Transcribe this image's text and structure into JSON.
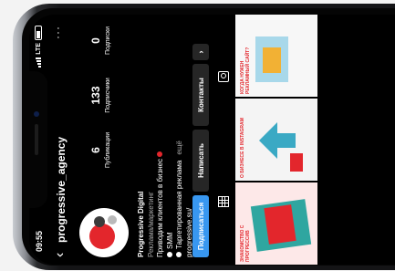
{
  "status": {
    "time": "09:55",
    "network": "LTE"
  },
  "profile": {
    "username": "progressive_agency",
    "posts_count": "6",
    "posts_label": "Публикации",
    "followers_count": "133",
    "followers_label": "Подписчики",
    "following_count": "0",
    "following_label": "Подписки",
    "name": "Progressive Digital",
    "category": "Реклама/маркетинг",
    "bio_line1": "Приводим клиентов в бизнес",
    "bio_line2": "SMM",
    "bio_line3": "Таргетированная реклама",
    "more_link": "ещё",
    "website": "progressive.su/"
  },
  "buttons": {
    "follow": "Подписаться",
    "message": "Написать",
    "contacts": "Контакты"
  },
  "posts": [
    {
      "caption": "ЗНАКОМСТВО С ПРОГРЕССИВ"
    },
    {
      "caption": "О БИЗНЕСЕ В INSTAGRAM"
    },
    {
      "caption": "КОГДА НУЖЕН РЕКЛАМНЫЙ САЙТ?"
    }
  ],
  "colors": {
    "accent": "#3897f0",
    "brand_red": "#e3262c",
    "background": "#000000"
  }
}
